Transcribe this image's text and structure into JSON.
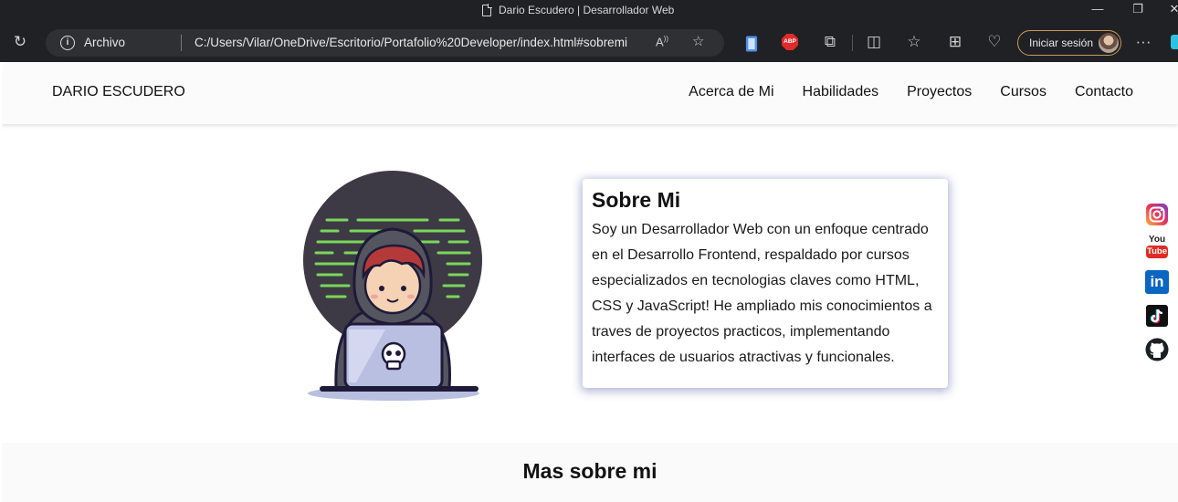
{
  "browser": {
    "window_title": "Dario Escudero | Desarrollador Web",
    "site_label": "Archivo",
    "url": "C:/Users/Vilar/OneDrive/Escritorio/Portafolio%20Developer/index.html#sobremi",
    "signin_label": "Iniciar sesión",
    "abp_label": "ABP"
  },
  "nav": {
    "brand": "DARIO ESCUDERO",
    "links": [
      "Acerca de Mi",
      "Habilidades",
      "Proyectos",
      "Cursos",
      "Contacto"
    ]
  },
  "about": {
    "title": "Sobre Mi",
    "text": "Soy un Desarrollador Web con un enfoque centrado en el Desarrollo Frontend, respaldado por cursos especializados en tecnologias claves como HTML, CSS y JavaScript! He ampliado mis conocimientos a traves de proyectos practicos, implementando interfaces de usuarios atractivas y funcionales."
  },
  "social": {
    "youtube_top": "You",
    "youtube_bottom": "Tube",
    "linkedin": "in"
  },
  "more": {
    "title": "Mas sobre mi"
  },
  "colors": {
    "chrome_bg": "#202124",
    "card_shadow": "#5a5aaa",
    "code_green": "#7bd65a",
    "hood_dark": "#3d3a45"
  }
}
